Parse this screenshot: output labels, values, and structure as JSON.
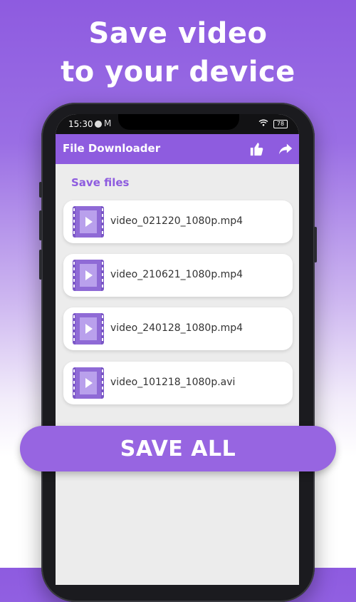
{
  "headline": {
    "line1": "Save video",
    "line2": "to your device"
  },
  "status_bar": {
    "time": "15:30",
    "battery": "78"
  },
  "app_bar": {
    "title": "File Downloader",
    "actions": [
      "like-icon",
      "share-icon"
    ]
  },
  "section": {
    "title": "Save files"
  },
  "files": [
    {
      "name": "video_021220_1080p.mp4"
    },
    {
      "name": "video_210621_1080p.mp4"
    },
    {
      "name": "video_240128_1080p.mp4"
    },
    {
      "name": "video_101218_1080p.avi"
    }
  ],
  "save_all_label": "SAVE ALL",
  "colors": {
    "accent": "#8e5cdf",
    "background_top": "#8e5be0",
    "screen_bg": "#ececec"
  }
}
